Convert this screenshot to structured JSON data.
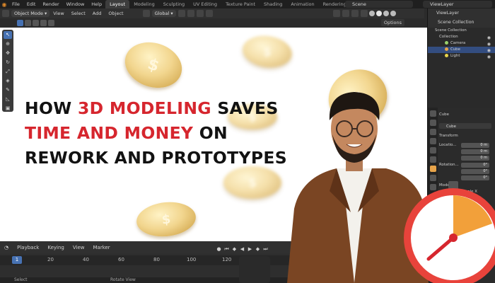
{
  "menubar": {
    "items": [
      "File",
      "Edit",
      "Render",
      "Window",
      "Help"
    ],
    "workspaces": [
      "Layout",
      "Modeling",
      "Sculpting",
      "UV Editing",
      "Texture Paint",
      "Shading",
      "Animation",
      "Rendering"
    ],
    "active_workspace": "Layout",
    "scene": "Scene",
    "view_layer": "ViewLayer"
  },
  "viewport_header": {
    "mode": "Object Mode",
    "menus": [
      "View",
      "Select",
      "Add",
      "Object"
    ],
    "transform": "Global",
    "options": "Options"
  },
  "headline": {
    "line1_pre": "HOW ",
    "line1_red": "3D MODELING",
    "line1_post": " SAVES",
    "line2_red": "TIME AND MONEY",
    "line2_post": " ON",
    "line3": "REWORK AND PROTOTYPES"
  },
  "coin_symbol": "$",
  "outliner": {
    "header": "Scene Collection",
    "view_layer": "ViewLayer",
    "items": [
      {
        "label": "Scene Collection",
        "indent": 0
      },
      {
        "label": "Collection",
        "indent": 1
      },
      {
        "label": "Camera",
        "indent": 2,
        "color": "#9ad06b"
      },
      {
        "label": "Cube",
        "indent": 2,
        "color": "#e8a44a"
      },
      {
        "label": "Light",
        "indent": 2,
        "color": "#e8d44a"
      }
    ]
  },
  "properties": {
    "object_name": "Cube",
    "object_label": "Cube",
    "section": "Transform",
    "location_label": "Locatio...",
    "rotation_label": "Rotation...",
    "mode_label": "Mode",
    "scale_label": "Scale X",
    "axes": [
      "X",
      "Y",
      "Z"
    ],
    "loc_values": [
      "0 m",
      "0 m",
      "0 m"
    ],
    "rot_values": [
      "0°",
      "0°",
      "0°"
    ]
  },
  "timeline": {
    "menus": [
      "Playback",
      "Keying",
      "View",
      "Marker"
    ],
    "current_frame": "1",
    "ticks": [
      "20",
      "40",
      "60",
      "80",
      "100",
      "120"
    ],
    "status_left": "Select",
    "status_mid": "Rotate View"
  },
  "colors": {
    "accent_red": "#d6262e",
    "blender_blue": "#4772b3",
    "coin_gold": "#e6c06a"
  }
}
